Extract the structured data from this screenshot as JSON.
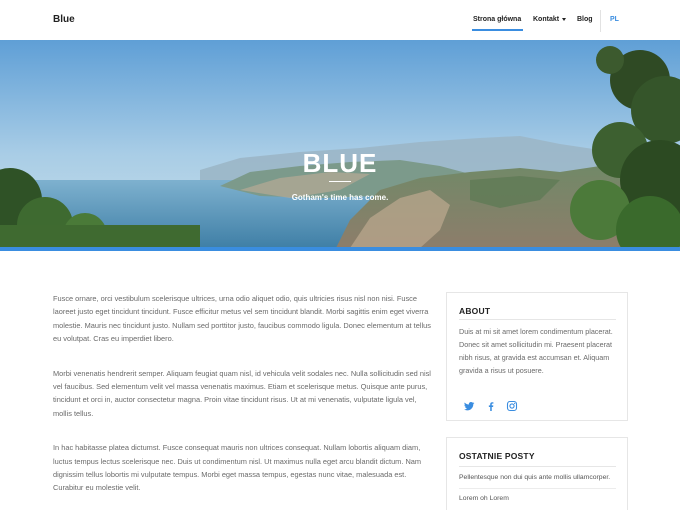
{
  "header": {
    "brand": "Blue",
    "nav": [
      {
        "label": "Strona główna"
      },
      {
        "label": "Kontakt"
      },
      {
        "label": "Blog"
      }
    ],
    "lang": "PL"
  },
  "hero": {
    "title": "BLUE",
    "subtitle": "Gotham's time has come."
  },
  "main": {
    "paragraphs": [
      "Fusce ornare, orci vestibulum scelerisque ultrices, urna odio aliquet odio, quis ultricies risus nisl non nisi. Fusce laoreet justo eget tincidunt tincidunt. Fusce efficitur metus vel sem tincidunt blandit. Morbi sagittis enim eget viverra molestie. Mauris nec tincidunt justo. Nullam sed porttitor justo, faucibus commodo ligula. Donec elementum at tellus eu volutpat. Cras eu imperdiet libero.",
      "Morbi venenatis hendrerit semper. Aliquam feugiat quam nisl, id vehicula velit sodales nec. Nulla sollicitudin sed nisl vel faucibus. Sed elementum velit vel massa venenatis maximus. Etiam et scelerisque metus. Quisque ante purus, tincidunt et orci in, auctor consectetur magna. Proin vitae tincidunt risus. Ut at mi venenatis, vulputate ligula vel, mollis tellus.",
      "In hac habitasse platea dictumst. Fusce consequat mauris non ultrices consequat. Nullam lobortis aliquam diam, luctus tempus lectus scelerisque nec. Duis ut condimentum nisl. Ut maximus nulla eget arcu blandit dictum. Nam dignissim tellus lobortis mi vulputate tempus. Morbi eget massa tempus, egestas nunc vitae, malesuada est. Curabitur eu molestie velit."
    ]
  },
  "sidebar": {
    "about": {
      "title": "ABOUT",
      "text": "Duis at mi sit amet lorem condimentum placerat. Donec sit amet sollicitudin mi. Praesent placerat nibh risus, at gravida est accumsan et. Aliquam gravida a risus ut posuere.",
      "socials": [
        "twitter-icon",
        "facebook-icon",
        "instagram-icon"
      ]
    },
    "recent": {
      "title": "OSTATNIE POSTY",
      "items": [
        "Pellentesque non dui quis ante mollis ullamcorper.",
        "Lorem oh Lorem"
      ]
    }
  },
  "colors": {
    "accent": "#3a8de0",
    "text": "#6a6a6a"
  }
}
